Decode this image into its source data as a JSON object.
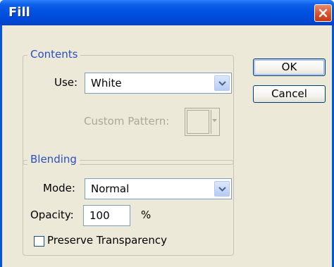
{
  "window": {
    "title": "Fill"
  },
  "contents": {
    "legend": "Contents",
    "use_label": "Use:",
    "use_value": "White",
    "custom_pattern_label": "Custom Pattern:"
  },
  "blending": {
    "legend": "Blending",
    "mode_label": "Mode:",
    "mode_value": "Normal",
    "opacity_label": "Opacity:",
    "opacity_value": "100",
    "opacity_unit": "%",
    "preserve_label": "Preserve Transparency",
    "preserve_checked": false
  },
  "buttons": {
    "ok": "OK",
    "cancel": "Cancel"
  },
  "icons": {
    "close": "close-icon",
    "dropdown": "chevron-down-icon"
  },
  "colors": {
    "titlebar": "#0055e5",
    "face": "#ece9d8",
    "legend_text": "#2a4fc0"
  }
}
